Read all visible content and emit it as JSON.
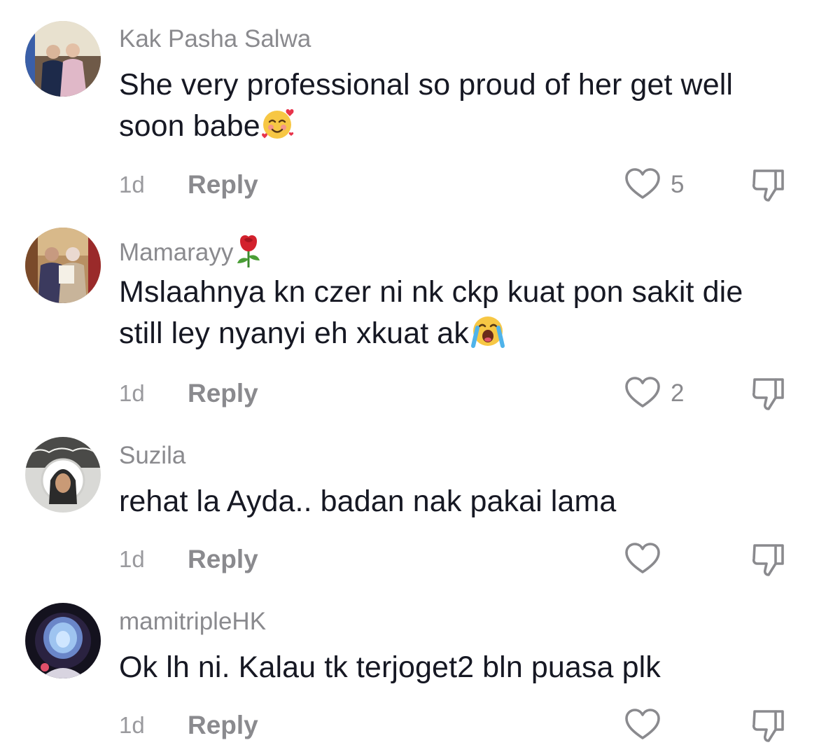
{
  "comments": [
    {
      "username": "Kak Pasha Salwa",
      "text": "She very professional so proud of her get well soon babe",
      "text_emoji": "smiling-face-with-hearts",
      "time": "1d",
      "reply_label": "Reply",
      "likes": "5"
    },
    {
      "username": "Mamarayy",
      "username_emoji": "rose",
      "text": "Mslaahnya kn czer ni nk ckp kuat pon sakit die still ley nyanyi eh xkuat ak",
      "text_emoji": "loudly-crying-face",
      "time": "1d",
      "reply_label": "Reply",
      "likes": "2"
    },
    {
      "username": "Suzila",
      "text": "rehat la Ayda.. badan nak pakai lama",
      "time": "1d",
      "reply_label": "Reply",
      "likes": ""
    },
    {
      "username": "mamitripleHK",
      "text": "Ok lh ni. Kalau tk terjoget2 bln puasa plk",
      "time": "1d",
      "reply_label": "Reply",
      "likes": ""
    }
  ],
  "icons": {
    "like": "heart-outline-icon",
    "dislike": "thumbs-down-outline-icon"
  },
  "colors": {
    "text": "#161823",
    "secondary": "#8a8a8e",
    "icon": "#8a8a8e"
  }
}
